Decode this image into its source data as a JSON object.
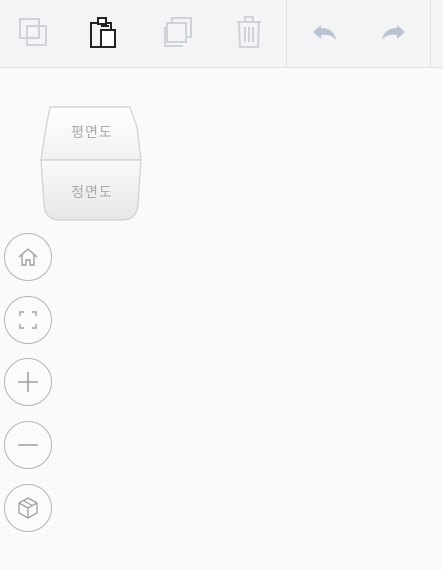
{
  "toolbar": {
    "buttons": [
      {
        "icon": "copy-icon",
        "enabled": false
      },
      {
        "icon": "paste-icon",
        "enabled": true
      },
      {
        "icon": "duplicate-icon",
        "enabled": false
      },
      {
        "icon": "trash-icon",
        "enabled": false
      },
      {
        "icon": "undo-icon",
        "enabled": false
      },
      {
        "icon": "redo-icon",
        "enabled": false
      }
    ]
  },
  "viewcube": {
    "top_label": "평면도",
    "front_label": "정면도"
  },
  "nav": {
    "buttons": [
      {
        "icon": "home-icon"
      },
      {
        "icon": "fit-view-icon"
      },
      {
        "icon": "zoom-in-icon"
      },
      {
        "icon": "zoom-out-icon"
      },
      {
        "icon": "3d-view-icon"
      }
    ]
  },
  "colors": {
    "icon_disabled": "#cfd2d8",
    "icon_active": "#222222",
    "undo_redo": "#b9c4d2",
    "nav_icon": "#a0a0a0",
    "toolbar_bg": "#f4f4f6",
    "canvas_bg": "#fafafa"
  }
}
